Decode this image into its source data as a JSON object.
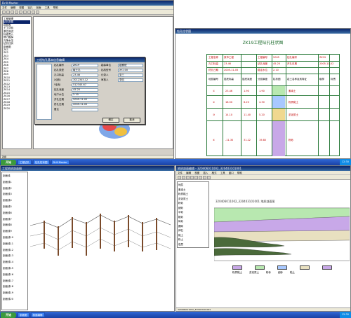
{
  "top_left_window": {
    "title": "Drill Master",
    "menu": [
      "文件",
      "编辑",
      "视图",
      "钻孔",
      "剖面",
      "工具",
      "帮助"
    ],
    "tree_items": [
      "工程管理",
      "钻孔数据",
      "地层表",
      "土工试验",
      "原位测试",
      "标准贯入",
      "静力触探",
      "孔隙水压",
      "钻孔柱状",
      "剖面图",
      "ZK1",
      "ZK2",
      "ZK3",
      "ZK4",
      "ZK5",
      "ZK6",
      "ZK7",
      "ZK8",
      "ZK9",
      "ZK10",
      "ZK11",
      "ZK12",
      "ZK13",
      "ZK14",
      "ZK15",
      "ZK16",
      "ZK17",
      "ZK18",
      "ZK19",
      "ZK20"
    ],
    "tree_highlight": "钻孔数据",
    "dialog": {
      "title": "工程钻孔基本信息编辑",
      "labels": [
        "钻孔编号",
        "钻孔类型",
        "孔口标高",
        "X坐标",
        "Y坐标",
        "钻孔深度",
        "地下水位",
        "开孔日期",
        "终孔日期",
        "备注"
      ],
      "values": [
        "ZK19",
        "取土孔",
        "23.46",
        "3012345.12",
        "512345.67",
        "45.20",
        "2.10",
        "2005-11-02",
        "2005-11-05",
        ""
      ],
      "right_labels": [
        "勘探单位",
        "钻机型号",
        "记录人",
        "审核人"
      ],
      "right_values": [
        "勘察院",
        "XY-100",
        "张三",
        "李四"
      ],
      "ok": "确定",
      "cancel": "取消"
    },
    "status": "就绪"
  },
  "top_right_window": {
    "title": "钻孔柱状图",
    "report_title": "ZK19工程钻孔柱状图",
    "header_labels": [
      "工程名称",
      "工程编号",
      "钻孔编号",
      "孔口标高",
      "钻孔深度",
      "开孔日期",
      "终孔日期",
      "稳定水位"
    ],
    "header_values": [
      "某市工程",
      "2005",
      "ZK19",
      "23.46",
      "45.20",
      "2005-11-02",
      "2005-11-05",
      "2.10"
    ],
    "columns": [
      "地层编号",
      "层底标高",
      "层底深度",
      "分层厚度",
      "柱状图",
      "岩土名称及其特征",
      "取样",
      "标贯"
    ],
    "layers": [
      {
        "id": "①",
        "elev": "23.46",
        "depth": "1.90",
        "thick": "1.90",
        "desc": "素填土"
      },
      {
        "id": "②",
        "elev": "18.50",
        "depth": "6.20",
        "thick": "4.30",
        "desc": "粉质黏土"
      },
      {
        "id": "③",
        "elev": "14.10",
        "depth": "11.40",
        "thick": "5.20",
        "desc": "淤泥质土"
      },
      {
        "id": "④",
        "elev": "-11.30",
        "depth": "31.22",
        "thick": "19.80",
        "desc": "粉砂"
      }
    ]
  },
  "bottom_left_window": {
    "title": "工程地质剖面图",
    "tree_items": [
      "剖面线",
      "剖面线1",
      "剖面线2",
      "剖面线3",
      "剖面线4",
      "剖面线5",
      "剖面线6",
      "剖面线7",
      "剖面线8",
      "剖面线9",
      "剖面线10",
      "剖面线11",
      "剖面线12",
      "剖面线13",
      "剖面线14",
      "剖面线15",
      "剖面线16",
      "剖面线17",
      "剖面线18",
      "剖面线19",
      "剖面线20"
    ],
    "boreholes": [
      "ZK1",
      "ZK2",
      "ZK3",
      "ZK4",
      "ZK5",
      "ZK6",
      "ZK7",
      "ZK8",
      "ZK9",
      "ZK10",
      "ZK11",
      "ZK12"
    ]
  },
  "bottom_right_window": {
    "title": "地质剖面编辑 - 320406011002_320403101001",
    "menu": [
      "文件",
      "编辑",
      "视图",
      "插入",
      "格式",
      "工具",
      "窗口",
      "帮助"
    ],
    "section_title": "320406011002_320403101001 地质剖面图",
    "tree_items": [
      "地层",
      "素填土",
      "粉质黏土",
      "淤泥质土",
      "粉砂",
      "细砂",
      "中砂",
      "粗砂",
      "砾砂",
      "圆砾",
      "卵石",
      "黏土",
      "粉土",
      "岩层"
    ],
    "legend": [
      "粉质黏土",
      "淤泥质土",
      "粉砂",
      "细砂",
      "黏土"
    ],
    "status": "320406011002_320403101001"
  },
  "taskbar": {
    "start": "开始",
    "tasks": [
      "工程钻孔",
      "钻孔柱状图",
      "Drill Master",
      "剖面图",
      "剖面编辑"
    ],
    "clock": "12:30"
  },
  "colors": {
    "title_blue": "#0a246a",
    "report_green": "#2a7a3a",
    "layer_purple": "#c8a8e8",
    "layer_green": "#b8e8b0",
    "layer_blue": "#a8c8ff"
  }
}
